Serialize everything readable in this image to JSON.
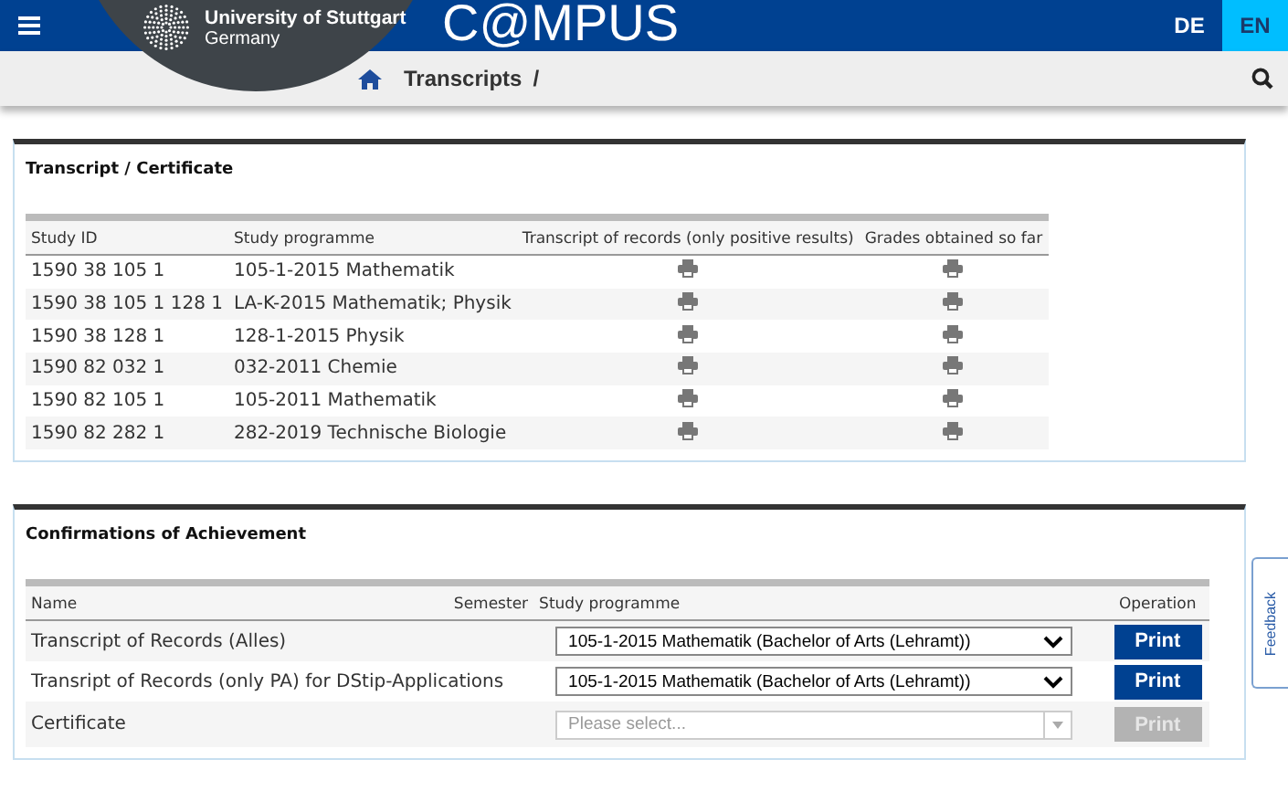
{
  "header": {
    "university": "University of Stuttgart",
    "country": "Germany",
    "app_title": "C@MPUS",
    "languages": [
      {
        "label": "DE",
        "selected": false
      },
      {
        "label": "EN",
        "selected": true
      }
    ]
  },
  "breadcrumb": {
    "items": [
      "Transcripts",
      "/"
    ]
  },
  "transcripts": {
    "title": "Transcript / Certificate",
    "columns": [
      "Study ID",
      "Study programme",
      "Transcript of records (only positive results)",
      "Grades obtained so far"
    ],
    "rows": [
      {
        "study_id": "1590 38 105 1",
        "programme": "105-1-2015 Mathematik"
      },
      {
        "study_id": "1590 38 105 1 128 1",
        "programme": "LA-K-2015 Mathematik; Physik"
      },
      {
        "study_id": "1590 38 128 1",
        "programme": "128-1-2015 Physik"
      },
      {
        "study_id": "1590 82 032 1",
        "programme": "032-2011 Chemie"
      },
      {
        "study_id": "1590 82 105 1",
        "programme": "105-2011 Mathematik"
      },
      {
        "study_id": "1590 82 282 1",
        "programme": "282-2019 Technische Biologie"
      }
    ]
  },
  "confirmations": {
    "title": "Confirmations of Achievement",
    "columns": [
      "Name",
      "Semester",
      "Study programme",
      "Operation"
    ],
    "rows": [
      {
        "name": "Transcript of Records (Alles)",
        "programme": {
          "value": "105-1-2015 Mathematik (Bachelor of Arts (Lehramt))",
          "disabled": false
        },
        "button": {
          "label": "Print",
          "disabled": false
        }
      },
      {
        "name": "Transript of Records (only PA) for DStip-Applications",
        "programme": {
          "value": "105-1-2015 Mathematik (Bachelor of Arts (Lehramt))",
          "disabled": false
        },
        "button": {
          "label": "Print",
          "disabled": false
        }
      },
      {
        "name": "Certificate",
        "programme": {
          "placeholder": "Please select...",
          "disabled": true
        },
        "button": {
          "label": "Print",
          "disabled": true
        }
      }
    ]
  },
  "feedback": "Feedback"
}
